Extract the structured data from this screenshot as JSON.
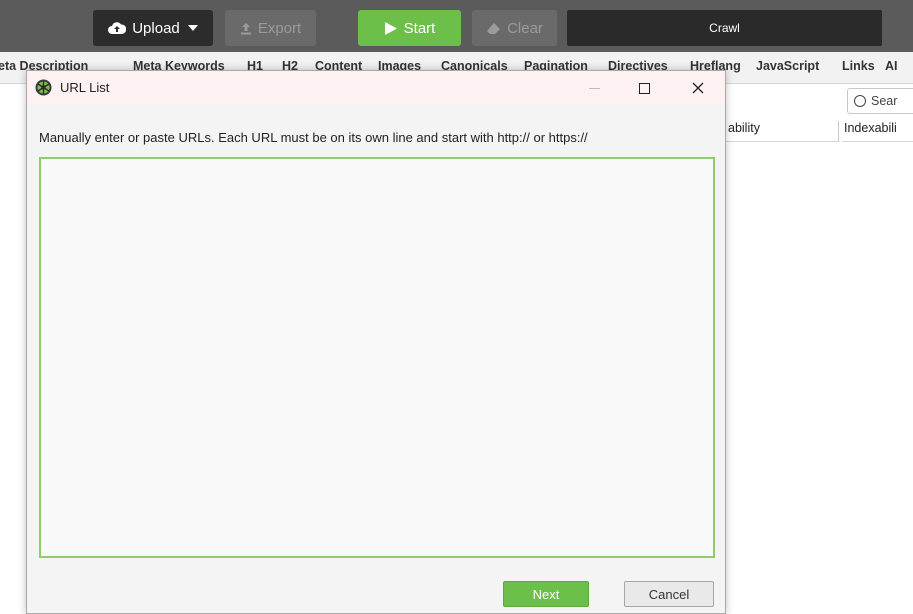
{
  "toolbar": {
    "upload_label": "Upload",
    "export_label": "Export",
    "start_label": "Start",
    "clear_label": "Clear",
    "crawl_label": "Crawl"
  },
  "tabs": [
    "eta Description",
    "Meta Keywords",
    "H1",
    "H2",
    "Content",
    "Images",
    "Canonicals",
    "Pagination",
    "Directives",
    "Hreflang",
    "JavaScript",
    "Links",
    "AI"
  ],
  "background": {
    "search_placeholder": "Sear",
    "columns": [
      "ability",
      "Indexabili"
    ]
  },
  "dialog": {
    "title": "URL List",
    "instructions": "Manually enter or paste URLs. Each URL must be on its own line and start with http:// or https://",
    "textarea_value": "",
    "next_label": "Next",
    "cancel_label": "Cancel"
  },
  "colors": {
    "accent_green": "#6cc04a",
    "toolbar_bg": "#5b5b5b",
    "textarea_border": "#8ccf6a"
  }
}
